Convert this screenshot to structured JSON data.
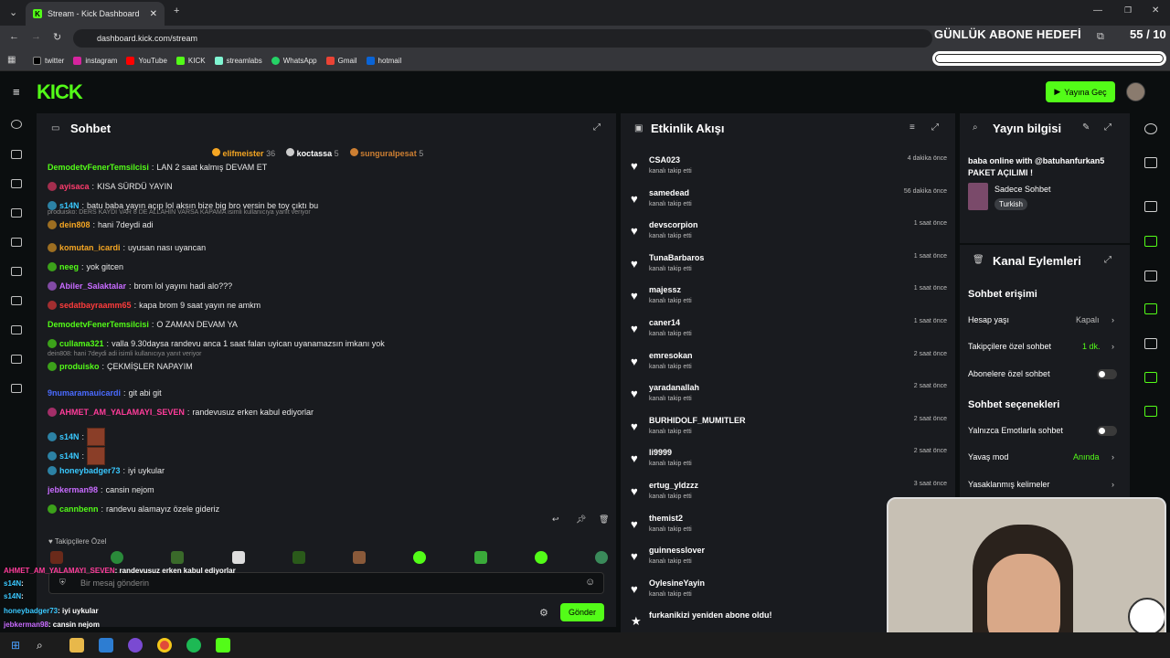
{
  "browser": {
    "tab_title": "Stream - Kick Dashboard",
    "url": "dashboard.kick.com/stream",
    "bookmarks": [
      "twitter",
      "instagram",
      "YouTube",
      "KICK",
      "streamlabs",
      "WhatsApp",
      "Gmail",
      "hotmail"
    ]
  },
  "overlay": {
    "goal_title": "GÜNLÜK ABONE HEDEFİ",
    "goal_count": "55 / 10",
    "goal_progress": 1.0
  },
  "header": {
    "logo": "KICK",
    "go_live": "Yayına Geç"
  },
  "chat": {
    "title": "Sohbet",
    "top_gifters": [
      {
        "name": "elifmeister",
        "count": "36"
      },
      {
        "name": "koctassa",
        "count": "5"
      },
      {
        "name": "sunguralpesat",
        "count": "5"
      }
    ],
    "messages": [
      {
        "user": "DemodetvFenerTemsilcisi",
        "text": "LAN 2 saat kalmış DEVAM ET",
        "color": "#53fc18"
      },
      {
        "user": "ayisaca",
        "text": "KISA SÜRDÜ YAYIN",
        "color": "#ff3c6e"
      },
      {
        "user": "s14N",
        "text": "batu baba yayın açıp lol aksın bize big bro versin be toy çıktı bu",
        "color": "#39c8ff"
      },
      {
        "user": "dein808",
        "text": "hani 7deydi adi",
        "color": "#f5a623",
        "reply": "produisko: DERS KAYDI VAR 8 DE ALLAHIN VARSA KAPAMA isimli kullanıcıya yanıt veriyor"
      },
      {
        "user": "komutan_icardi",
        "text": "uyusan nası uyancan",
        "color": "#f5a623"
      },
      {
        "user": "neeg",
        "text": "yok gitcen",
        "color": "#53fc18"
      },
      {
        "user": "Abiler_Salaktalar",
        "text": "brom lol yayını hadi alo???",
        "color": "#c86bff"
      },
      {
        "user": "sedatbayraamm65",
        "text": "kapa brom 9 saat yayın ne amkm",
        "color": "#ff3c3c"
      },
      {
        "user": "DemodetvFenerTemsilcisi",
        "text": "O ZAMAN DEVAM YA",
        "color": "#53fc18"
      },
      {
        "user": "cullama321",
        "text": "valla 9.30daysa randevu anca 1 saat falan uyican uyanamazsın imkanı yok",
        "color": "#53fc18"
      },
      {
        "user": "produisko",
        "text": "ÇEKMİŞLER NAPAYIM",
        "color": "#53fc18",
        "reply": "dein808: hani 7deydi adi isimli kullanıcıya yanıt veriyor"
      },
      {
        "user": "9numaramauicardi",
        "text": "git abi git",
        "color": "#4a6bff"
      },
      {
        "user": "AHMET_AM_YALAMAYI_SEVEN",
        "text": "randevusuz erken kabul ediyorlar",
        "color": "#ff3c9a"
      },
      {
        "user": "s14N",
        "text": "",
        "color": "#39c8ff"
      },
      {
        "user": "s14N",
        "text": "",
        "color": "#39c8ff"
      },
      {
        "user": "honeybadger73",
        "text": "iyi uykular",
        "color": "#39c8ff"
      },
      {
        "user": "jebkerman98",
        "text": "cansin nejom",
        "color": "#c86bff"
      },
      {
        "user": "cannbenn",
        "text": "randevu alamayız özele gideriz",
        "color": "#53fc18"
      }
    ],
    "followers_only": "Takipçilere Özel",
    "input_placeholder": "Bir mesaj gönderin",
    "send": "Gönder"
  },
  "activity": {
    "title": "Etkinlik Akışı",
    "items": [
      {
        "name": "CSA023",
        "sub": "kanalı takip etti",
        "time": "4 dakika önce"
      },
      {
        "name": "samedead",
        "sub": "kanalı takip etti",
        "time": "56 dakika önce"
      },
      {
        "name": "devscorpion",
        "sub": "kanalı takip etti",
        "time": "1 saat önce"
      },
      {
        "name": "TunaBarbaros",
        "sub": "kanalı takip etti",
        "time": "1 saat önce"
      },
      {
        "name": "majessz",
        "sub": "kanalı takip etti",
        "time": "1 saat önce"
      },
      {
        "name": "caner14",
        "sub": "kanalı takip etti",
        "time": "1 saat önce"
      },
      {
        "name": "emresokan",
        "sub": "kanalı takip etti",
        "time": "2 saat önce"
      },
      {
        "name": "yaradanallah",
        "sub": "kanalı takip etti",
        "time": "2 saat önce"
      },
      {
        "name": "BURHIDOLF_MUMITLER",
        "sub": "kanalı takip etti",
        "time": "2 saat önce"
      },
      {
        "name": "li9999",
        "sub": "kanalı takip etti",
        "time": "2 saat önce"
      },
      {
        "name": "ertug_yldzzz",
        "sub": "kanalı takip etti",
        "time": "3 saat önce"
      },
      {
        "name": "themist2",
        "sub": "kanalı takip etti",
        "time": ""
      },
      {
        "name": "guinnesslover",
        "sub": "kanalı takip etti",
        "time": ""
      },
      {
        "name": "OylesineYayin",
        "sub": "kanalı takip etti",
        "time": ""
      },
      {
        "name": "furkanikizi yeniden abone oldu!",
        "sub": "",
        "time": ""
      }
    ]
  },
  "info": {
    "title": "Yayın bilgisi",
    "stream_title": "baba online with @batuhanfurkan5 PAKET AÇILIMI !",
    "category": "Sadece Sohbet",
    "language": "Turkish"
  },
  "channel": {
    "title": "Kanal Eylemleri",
    "section1": "Sohbet erişimi",
    "age_label": "Hesap yaşı",
    "age_value": "Kapalı",
    "followers_label": "Takipçilere özel sohbet",
    "followers_value": "1 dk.",
    "subs_label": "Abonelere özel sohbet",
    "section2": "Sohbet seçenekleri",
    "emote_label": "Yalnızca Emotlarla sohbet",
    "slow_label": "Yavaş mod",
    "slow_value": "Anında",
    "banned_label": "Yasaklanmış kelimeler"
  },
  "overlay_chat": [
    {
      "user": "AHMET_AM_YALAMAYI_SEVEN",
      "text": ": randevusuz erken kabul ediyorlar",
      "color": "#ff3c9a"
    },
    {
      "user": "s14N",
      "text": ":",
      "color": "#39c8ff"
    },
    {
      "user": "s14N",
      "text": ":",
      "color": "#39c8ff"
    },
    {
      "user": "honeybadger73",
      "text": ": iyi uykular",
      "color": "#39c8ff"
    },
    {
      "user": "jebkerman98",
      "text": ": cansin nejom",
      "color": "#c86bff"
    },
    {
      "user": "cannbenn",
      "text": ": randevu alamayız özele gideriz",
      "color": "#53fc18"
    }
  ]
}
